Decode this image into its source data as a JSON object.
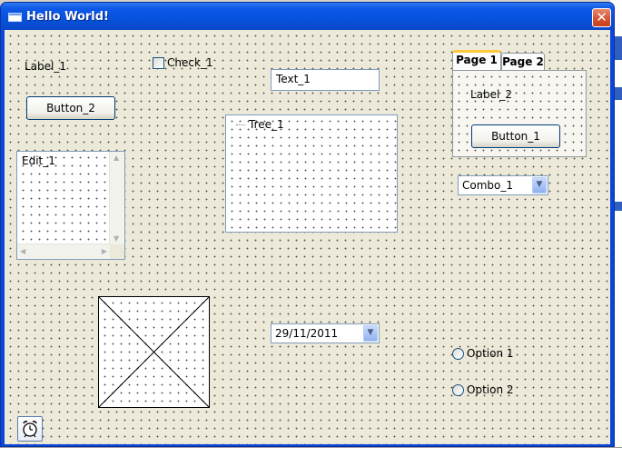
{
  "window": {
    "title": "Hello World!",
    "close_glyph": "✕",
    "accent_color": "#0a46d8"
  },
  "controls": {
    "label_1": "Label_1",
    "check_1": "Check_1",
    "text_1": "Text_1",
    "button_2": "Button_2",
    "edit_1": "Edit_1",
    "tree_1": "Tree_1",
    "tabs": [
      {
        "label": "Page 1",
        "active": true
      },
      {
        "label": "Page 2",
        "active": false
      }
    ],
    "tab_page": {
      "label_2": "Label_2",
      "button_1": "Button_1"
    },
    "combo_1": "Combo_1",
    "date_picker": "29/11/2011",
    "option_1": "Option 1",
    "option_2": "Option 2",
    "timer_icon": "alarm-clock-icon",
    "image_icon": "image-placeholder-icon"
  }
}
